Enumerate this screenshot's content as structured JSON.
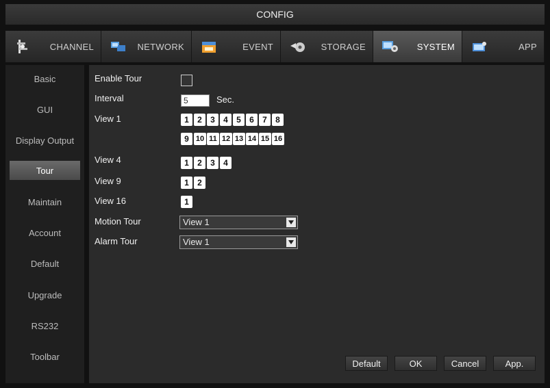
{
  "window": {
    "title": "CONFIG"
  },
  "tabs": [
    {
      "label": "CHANNEL",
      "icon": "channel-icon"
    },
    {
      "label": "NETWORK",
      "icon": "network-icon"
    },
    {
      "label": "EVENT",
      "icon": "event-icon"
    },
    {
      "label": "STORAGE",
      "icon": "storage-icon"
    },
    {
      "label": "SYSTEM",
      "icon": "system-icon",
      "active": true
    },
    {
      "label": "APP",
      "icon": "app-icon"
    }
  ],
  "sidebar": {
    "items": [
      {
        "label": "Basic"
      },
      {
        "label": "GUI"
      },
      {
        "label": "Display Output"
      },
      {
        "label": "Tour",
        "active": true
      },
      {
        "label": "Maintain"
      },
      {
        "label": "Account"
      },
      {
        "label": "Default"
      },
      {
        "label": "Upgrade"
      },
      {
        "label": "RS232"
      },
      {
        "label": "Toolbar"
      }
    ]
  },
  "form": {
    "enable_tour": {
      "label": "Enable Tour",
      "checked": false
    },
    "interval": {
      "label": "Interval",
      "value": "5",
      "unit": "Sec."
    },
    "view1": {
      "label": "View 1",
      "numbers": [
        "1",
        "2",
        "3",
        "4",
        "5",
        "6",
        "7",
        "8",
        "9",
        "10",
        "11",
        "12",
        "13",
        "14",
        "15",
        "16"
      ]
    },
    "view4": {
      "label": "View 4",
      "numbers": [
        "1",
        "2",
        "3",
        "4"
      ]
    },
    "view9": {
      "label": "View 9",
      "numbers": [
        "1",
        "2"
      ]
    },
    "view16": {
      "label": "View 16",
      "numbers": [
        "1"
      ]
    },
    "motion_tour": {
      "label": "Motion Tour",
      "value": "View 1"
    },
    "alarm_tour": {
      "label": "Alarm Tour",
      "value": "View 1"
    }
  },
  "buttons": {
    "default": "Default",
    "ok": "OK",
    "cancel": "Cancel",
    "apply": "App."
  }
}
